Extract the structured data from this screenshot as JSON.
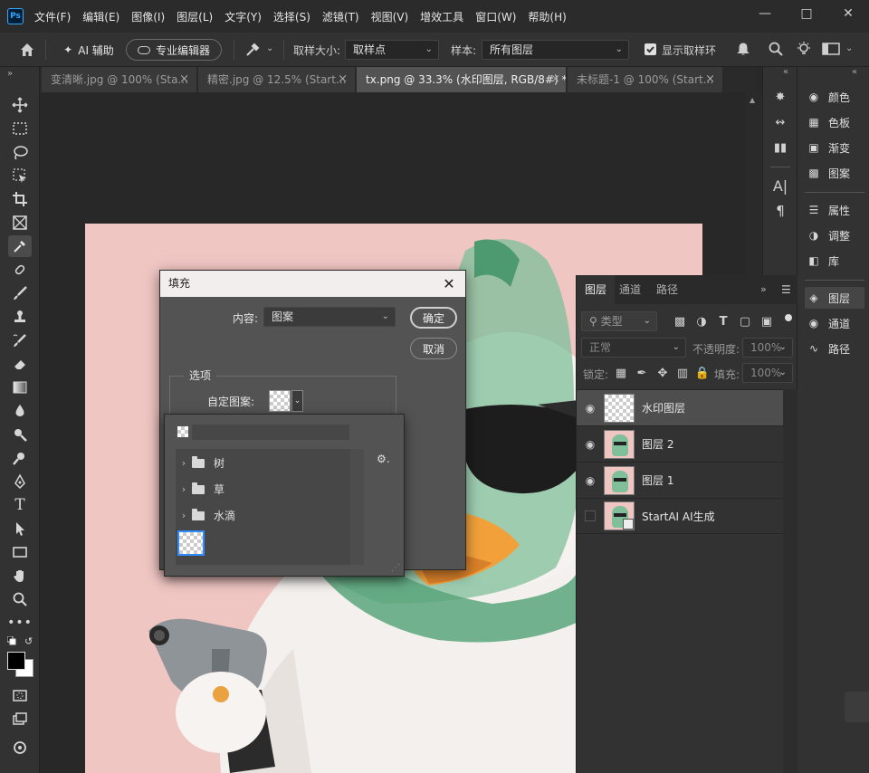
{
  "app": {
    "logo": "Ps"
  },
  "menu": [
    "文件(F)",
    "编辑(E)",
    "图像(I)",
    "图层(L)",
    "文字(Y)",
    "选择(S)",
    "滤镜(T)",
    "视图(V)",
    "增效工具",
    "窗口(W)",
    "帮助(H)"
  ],
  "options": {
    "ai_assist": "AI 辅助",
    "pro_editor": "专业编辑器",
    "sample_size_label": "取样大小:",
    "sample_size_value": "取样点",
    "sample_label": "样本:",
    "sample_value": "所有图层",
    "show_ring_label": "显示取样环",
    "show_ring_checked": true
  },
  "tabs": [
    {
      "label": "变清晰.jpg @ 100% (Sta...",
      "active": false
    },
    {
      "label": "精密.jpg @ 12.5% (Start...",
      "active": false
    },
    {
      "label": "tx.png @ 33.3% (水印图层, RGB/8#) *",
      "active": true
    },
    {
      "label": "未标题-1 @ 100% (Start...",
      "active": false
    }
  ],
  "right_panels": [
    {
      "label": "颜色",
      "icon": "palette-icon"
    },
    {
      "label": "色板",
      "icon": "swatches-icon"
    },
    {
      "label": "渐变",
      "icon": "gradient-icon"
    },
    {
      "label": "图案",
      "icon": "pattern-icon"
    },
    {
      "label": "属性",
      "icon": "properties-icon"
    },
    {
      "label": "调整",
      "icon": "adjustments-icon"
    },
    {
      "label": "库",
      "icon": "libraries-icon"
    },
    {
      "label": "图层",
      "icon": "layers-icon",
      "active": true
    },
    {
      "label": "通道",
      "icon": "channels-icon"
    },
    {
      "label": "路径",
      "icon": "paths-icon"
    }
  ],
  "layers_panel": {
    "tabs": [
      "图层",
      "通道",
      "路径"
    ],
    "filter_placeholder": "类型",
    "blend_mode": "正常",
    "opacity_label": "不透明度:",
    "opacity_value": "100%",
    "lock_label": "锁定:",
    "fill_label": "填充:",
    "fill_value": "100%",
    "layers": [
      {
        "name": "水印图层",
        "visible": true,
        "selected": true,
        "thumb": "transparent"
      },
      {
        "name": "图层 2",
        "visible": true,
        "selected": false,
        "thumb": "image"
      },
      {
        "name": "图层 1",
        "visible": true,
        "selected": false,
        "thumb": "image"
      },
      {
        "name": "StartAI AI生成",
        "visible": false,
        "selected": false,
        "thumb": "smart"
      }
    ]
  },
  "fill_dialog": {
    "title": "填充",
    "content_label": "内容:",
    "content_value": "图案",
    "ok": "确定",
    "cancel": "取消",
    "options_label": "选项",
    "custom_pattern_label": "自定图案:",
    "folders": [
      "树",
      "草",
      "水滴"
    ]
  },
  "colors": {
    "canvas_bg": "#282828",
    "doc_bg": "#f0c6c3",
    "panel_bg": "#323232",
    "dialog_bg": "#535353",
    "selected_pattern_border": "#2f8cff"
  }
}
